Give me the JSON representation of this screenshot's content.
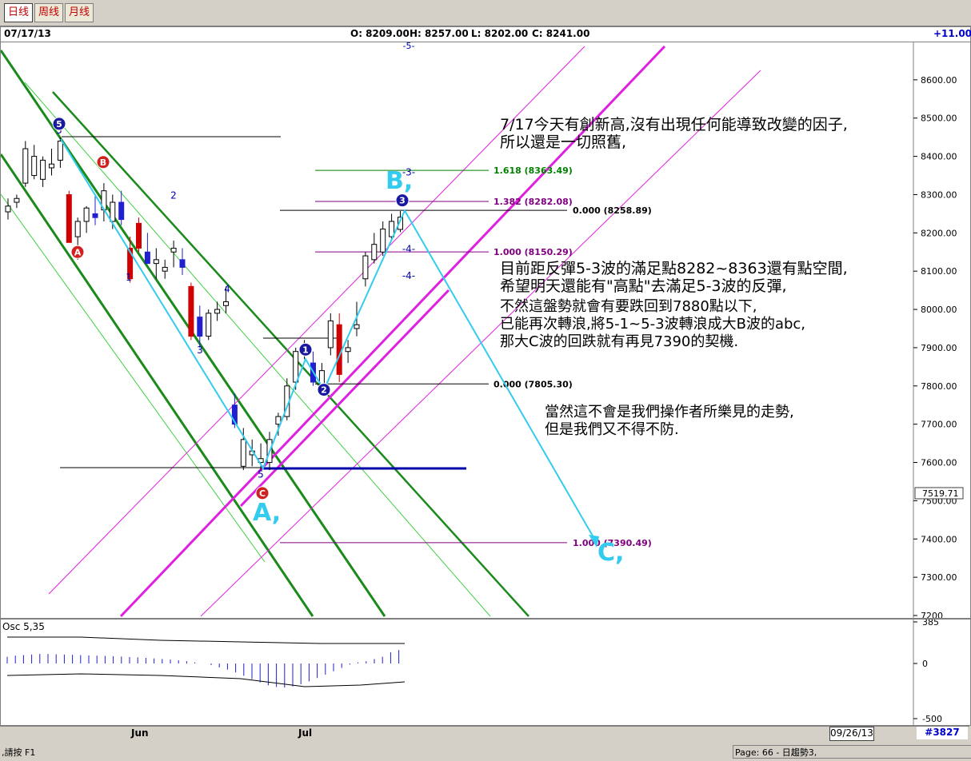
{
  "tabs": [
    "日线",
    "周线",
    "月线"
  ],
  "info": {
    "date": "07/17/13",
    "open": "O: 8209.00",
    "high": "H: 8257.00",
    "low": "L: 8202.00",
    "close": "C: 8241.00",
    "change": "+11.00"
  },
  "chart_data": {
    "type": "candlestick",
    "ylim": [
      7200,
      8700
    ],
    "yticks": [
      "8600.00",
      "8500.00",
      "8400.00",
      "8300.00",
      "8200.00",
      "8100.00",
      "8000.00",
      "7900.00",
      "7800.00",
      "7700.00",
      "7600.00",
      "7500.00",
      "7400.00",
      "7300.00",
      "7200"
    ],
    "last_price_label": "7519.71",
    "x_labels": [
      "Jun",
      "Jul"
    ],
    "top_label": "-5-",
    "fib_levels": [
      {
        "label": "1.618 (8363.49)",
        "value": 8363.49,
        "color": "#008000"
      },
      {
        "label": "1.382 (8282.08)",
        "value": 8282.08,
        "color": "#800080"
      },
      {
        "label": "0.000 (8258.89)",
        "value": 8258.89,
        "color": "#000000"
      },
      {
        "label": "1.000 (8150.29)",
        "value": 8150.29,
        "color": "#800080"
      },
      {
        "label": "0.000 (7805.30)",
        "value": 7805.3,
        "color": "#000000"
      },
      {
        "label": "1.000 (7390.49)",
        "value": 7390.49,
        "color": "#800080"
      }
    ],
    "wave_labels_small": [
      "5",
      "1",
      "2",
      "3",
      "4",
      "5",
      "-3-",
      "-4-",
      "-4-"
    ],
    "wave_circles": [
      "5",
      "B",
      "A",
      "1",
      "2",
      "3",
      "C"
    ],
    "big_labels": [
      "B,",
      "A,",
      "C,"
    ],
    "candles": [
      {
        "o": 8255,
        "h": 8290,
        "l": 8235,
        "c": 8270
      },
      {
        "o": 8280,
        "h": 8300,
        "l": 8265,
        "c": 8290
      },
      {
        "o": 8330,
        "h": 8440,
        "l": 8320,
        "c": 8420
      },
      {
        "o": 8350,
        "h": 8430,
        "l": 8340,
        "c": 8400
      },
      {
        "o": 8340,
        "h": 8400,
        "l": 8320,
        "c": 8390
      },
      {
        "o": 8370,
        "h": 8420,
        "l": 8350,
        "c": 8380
      },
      {
        "o": 8390,
        "h": 8450,
        "l": 8370,
        "c": 8440
      },
      {
        "o": 8300,
        "h": 8310,
        "l": 8180,
        "c": 8175
      },
      {
        "o": 8190,
        "h": 8240,
        "l": 8130,
        "c": 8230
      },
      {
        "o": 8230,
        "h": 8270,
        "l": 8200,
        "c": 8265
      },
      {
        "o": 8250,
        "h": 8300,
        "l": 8220,
        "c": 8240
      },
      {
        "o": 8260,
        "h": 8330,
        "l": 8230,
        "c": 8310
      },
      {
        "o": 8230,
        "h": 8300,
        "l": 8210,
        "c": 8280
      },
      {
        "o": 8280,
        "h": 8310,
        "l": 8220,
        "c": 8235
      },
      {
        "o": 8160,
        "h": 8190,
        "l": 8070,
        "c": 8080
      },
      {
        "o": 8225,
        "h": 8240,
        "l": 8150,
        "c": 8160
      },
      {
        "o": 8150,
        "h": 8200,
        "l": 8120,
        "c": 8120
      },
      {
        "o": 8120,
        "h": 8160,
        "l": 8080,
        "c": 8130
      },
      {
        "o": 8100,
        "h": 8130,
        "l": 8080,
        "c": 8110
      },
      {
        "o": 8150,
        "h": 8180,
        "l": 8110,
        "c": 8160
      },
      {
        "o": 8130,
        "h": 8160,
        "l": 8090,
        "c": 8110
      },
      {
        "o": 8060,
        "h": 8070,
        "l": 7920,
        "c": 7930
      },
      {
        "o": 7980,
        "h": 8010,
        "l": 7900,
        "c": 7930
      },
      {
        "o": 7930,
        "h": 8000,
        "l": 7920,
        "c": 7990
      },
      {
        "o": 7990,
        "h": 8020,
        "l": 7970,
        "c": 8000
      },
      {
        "o": 8010,
        "h": 8060,
        "l": 7990,
        "c": 8020
      },
      {
        "o": 7750,
        "h": 7780,
        "l": 7690,
        "c": 7700
      },
      {
        "o": 7590,
        "h": 7690,
        "l": 7580,
        "c": 7660
      },
      {
        "o": 7620,
        "h": 7660,
        "l": 7590,
        "c": 7630
      },
      {
        "o": 7600,
        "h": 7650,
        "l": 7580,
        "c": 7610
      },
      {
        "o": 7600,
        "h": 7680,
        "l": 7580,
        "c": 7660
      },
      {
        "o": 7700,
        "h": 7730,
        "l": 7670,
        "c": 7720
      },
      {
        "o": 7720,
        "h": 7820,
        "l": 7710,
        "c": 7800
      },
      {
        "o": 7810,
        "h": 7900,
        "l": 7790,
        "c": 7890
      },
      {
        "o": 7890,
        "h": 7920,
        "l": 7870,
        "c": 7900
      },
      {
        "o": 7860,
        "h": 7890,
        "l": 7800,
        "c": 7810
      },
      {
        "o": 7800,
        "h": 7860,
        "l": 7780,
        "c": 7840
      },
      {
        "o": 7900,
        "h": 7990,
        "l": 7880,
        "c": 7970
      },
      {
        "o": 7960,
        "h": 7990,
        "l": 7810,
        "c": 7830
      },
      {
        "o": 7890,
        "h": 7920,
        "l": 7860,
        "c": 7900
      },
      {
        "o": 7950,
        "h": 8020,
        "l": 7930,
        "c": 7960
      },
      {
        "o": 8080,
        "h": 8150,
        "l": 8060,
        "c": 8140
      },
      {
        "o": 8130,
        "h": 8200,
        "l": 8120,
        "c": 8170
      },
      {
        "o": 8150,
        "h": 8230,
        "l": 8140,
        "c": 8210
      },
      {
        "o": 8190,
        "h": 8250,
        "l": 8180,
        "c": 8230
      },
      {
        "o": 8209,
        "h": 8257,
        "l": 8202,
        "c": 8241
      }
    ],
    "osc": {
      "label": "Osc 5,35",
      "yticks": [
        "385",
        "0",
        "-500"
      ],
      "values": [
        60,
        70,
        75,
        80,
        85,
        85,
        82,
        80,
        78,
        75,
        72,
        70,
        68,
        65,
        62,
        58,
        55,
        50,
        45,
        40,
        35,
        28,
        20,
        10,
        0,
        -15,
        -35,
        -55,
        -80,
        -110,
        -140,
        -170,
        -195,
        -210,
        -215,
        -205,
        -185,
        -160,
        -130,
        -100,
        -70,
        -40,
        -10,
        10,
        20,
        40,
        60,
        100,
        120
      ]
    }
  },
  "annotations": [
    {
      "lines": [
        "7/17今天有創新高,沒有出現任何能導致改變的因子,",
        "所以還是一切照舊,"
      ],
      "color": "#1818c8"
    },
    {
      "lines": [
        "目前距反彈5-3波的滿足點8282~8363還有點空間,",
        "希望明天還能有\"高點\"去滿足5-3波的反彈,"
      ],
      "color": "#008000"
    },
    {
      "lines": [
        "不然這盤勢就會有要跌回到7880點以下,",
        "已能再次轉浪,將5-1~5-3波轉浪成大B波的abc,",
        "那大C波的回跌就有再見7390的契機."
      ],
      "color": "#33ccee"
    },
    {
      "lines": [
        "當然這不會是我們操作者所樂見的走勢,",
        "但是我們又不得不防."
      ],
      "color": "#e00000"
    }
  ],
  "datebar": {
    "date_box": "09/26/13",
    "count": "#3827"
  },
  "status": {
    "left": ",請按 F1",
    "right": "Page: 66 - 日趨勢3,"
  }
}
